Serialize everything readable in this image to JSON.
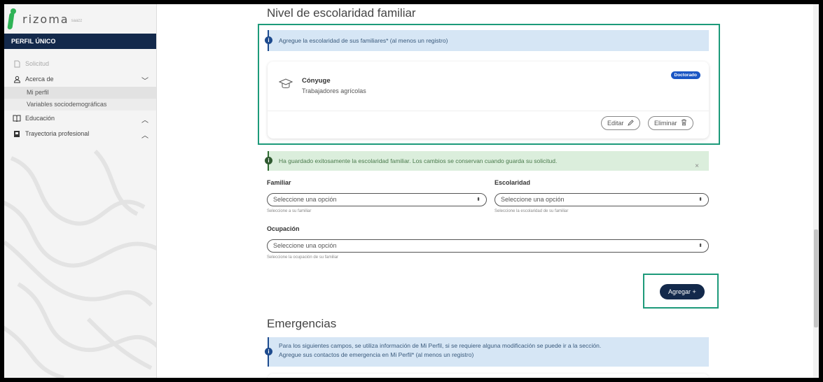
{
  "sidebar": {
    "logo_text": "rizoma",
    "logo_sub": "saazz",
    "header": "PERFIL ÚNICO",
    "items": [
      {
        "label": "Solicitud",
        "icon": "document-icon"
      },
      {
        "label": "Acerca de",
        "icon": "user-icon",
        "chevron": "﹀"
      },
      {
        "label": "Mi perfil"
      },
      {
        "label": "Variables sociodemográficas"
      },
      {
        "label": "Educación",
        "icon": "book-icon",
        "chevron": "︿"
      },
      {
        "label": "Trayectoria profesional",
        "icon": "badge-icon",
        "chevron": "︿"
      }
    ]
  },
  "section1": {
    "title": "Nivel de escolaridad familiar",
    "info": "Agregue la escolaridad de sus familiares* (al menos un registro)",
    "card": {
      "title": "Cónyuge",
      "subtitle": "Trabajadores agrícolas",
      "badge": "Doctorado",
      "edit_label": "Editar",
      "delete_label": "Eliminar"
    },
    "success": "Ha guardado exitosamente la escolaridad familiar. Los cambios se conservan cuando guarda su solicitud.",
    "close": "×",
    "fields": {
      "familiar": {
        "label": "Familiar",
        "value": "Seleccione una opción",
        "help": "Seleccione a su familiar"
      },
      "escolaridad": {
        "label": "Escolaridad",
        "value": "Seleccione una opción",
        "help": "Seleccione la escolaridad de su familiar"
      },
      "ocupacion": {
        "label": "Ocupación",
        "value": "Seleccione una opción",
        "help": "Seleccione la ocupación de su familiar"
      }
    },
    "add_button": "Agregar +"
  },
  "section2": {
    "title": "Emergencias",
    "info_line1": "Para los siguientes campos, se utiliza información de Mi Perfil, si se requiere alguna modificación se puede ir a la sección.",
    "info_line2": "Agregue sus contactos de emergencia en Mi Perfil* (al menos un registro)"
  },
  "colors": {
    "primary": "#13294b",
    "highlight": "#1d9a7a",
    "info_bg": "#d6e6f5",
    "success_bg": "#dbeedc",
    "badge": "#1a56c4"
  }
}
